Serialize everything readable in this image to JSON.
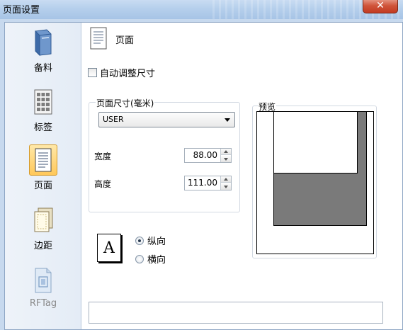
{
  "window": {
    "title": "页面设置",
    "close_label": "✕"
  },
  "sidebar": {
    "items": [
      {
        "label": "备料",
        "icon": "book-icon",
        "state": "normal"
      },
      {
        "label": "标签",
        "icon": "grid-sheet-icon",
        "state": "normal"
      },
      {
        "label": "页面",
        "icon": "page-icon",
        "state": "active"
      },
      {
        "label": "边距",
        "icon": "margins-icon",
        "state": "normal"
      },
      {
        "label": "RFTag",
        "icon": "rftag-icon",
        "state": "disabled"
      }
    ]
  },
  "page": {
    "header": "页面",
    "auto_size_label": "自动调整尺寸",
    "auto_size_checked": false
  },
  "size_group": {
    "legend": "页面尺寸(毫米)",
    "selected_size": "USER",
    "width_label": "宽度",
    "width_value": "88.00",
    "height_label": "高度",
    "height_value": "111.00"
  },
  "orientation": {
    "icon_letter": "A",
    "portrait_label": "纵向",
    "landscape_label": "横向",
    "selected": "portrait"
  },
  "preview": {
    "legend": "预览"
  },
  "status": {
    "text": ""
  },
  "colors": {
    "accent_active": "#ffc85a",
    "preview_paper": "#7a7a7a"
  }
}
